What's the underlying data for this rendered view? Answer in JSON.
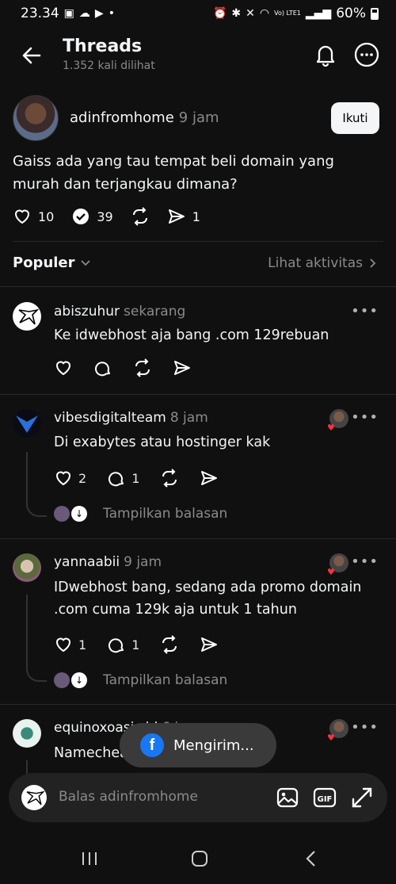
{
  "status": {
    "time": "23.34",
    "battery": "60%",
    "network": "Vo) LTE1"
  },
  "header": {
    "title": "Threads",
    "views": "1.352 kali dilihat"
  },
  "post": {
    "author": "adinfromhome",
    "time": "9 jam",
    "follow_label": "Ikuti",
    "text": "Gaiss ada yang tau tempat beli domain yang murah dan terjangkau dimana?",
    "likes": "10",
    "replies": "39",
    "shares": "1"
  },
  "sort": {
    "label": "Populer",
    "activity": "Lihat aktivitas"
  },
  "replies": [
    {
      "author": "abiszuhur",
      "time": "sekarang",
      "text": "Ke idwebhost aja bang .com 129rebuan",
      "likes": "",
      "replies": ""
    },
    {
      "author": "vibesdigitalteam",
      "time": "8 jam",
      "text": "Di exabytes atau hostinger kak",
      "likes": "2",
      "replies": "1",
      "show_replies": "Tampilkan balasan"
    },
    {
      "author": "yannaabii",
      "time": "9 jam",
      "text": "IDwebhost bang, sedang ada promo domain .com cuma 129k aja untuk 1 tahun",
      "likes": "1",
      "replies": "1",
      "show_replies": "Tampilkan balasan"
    },
    {
      "author": "equinoxoasis.id",
      "time": "6 jam",
      "text": "Namecheap"
    }
  ],
  "toast": {
    "label": "Mengirim..."
  },
  "composer": {
    "placeholder": "Balas adinfromhome"
  }
}
